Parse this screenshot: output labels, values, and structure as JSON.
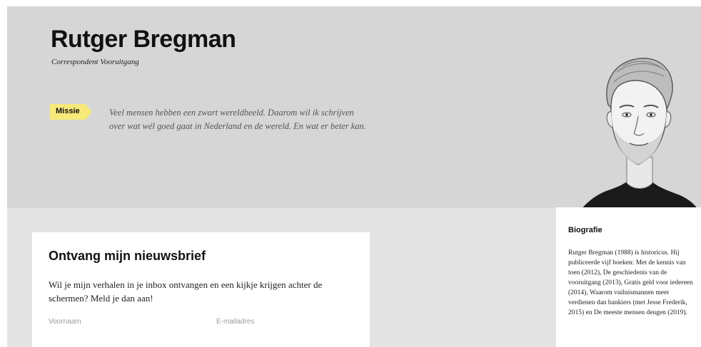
{
  "profile": {
    "name": "Rutger Bregman",
    "role": "Correspondent Vooruitgang"
  },
  "mission": {
    "tag": "Missie",
    "text": "Veel mensen hebben een zwart wereldbeeld. Daarom wil ik schrijven over wat wél goed gaat in Nederland en de wereld. En wat er beter kan."
  },
  "newsletter": {
    "title": "Ontvang mijn nieuwsbrief",
    "text": "Wil je mijn verhalen in je inbox ontvangen en een kijkje krijgen achter de schermen? Meld je dan aan!",
    "first_name_placeholder": "Voornaam",
    "email_placeholder": "E-mailadres"
  },
  "bio": {
    "title": "Biografie",
    "text": "Rutger Bregman (1988) is historicus. Hij publiceerde vijf boeken: Met de kennis van toen (2012), De geschiedenis van de vooruitgang (2013), Gratis geld voor iedereen (2014), Waarom vuilnismannen meer verdienen dan bankiers (met Jesse Frederik, 2015) en De meeste mensen deugen (2019)."
  },
  "colors": {
    "hero_background": "#d6d6d6",
    "page_background": "#e4e4e4",
    "mission_tag": "#f7e97a"
  }
}
